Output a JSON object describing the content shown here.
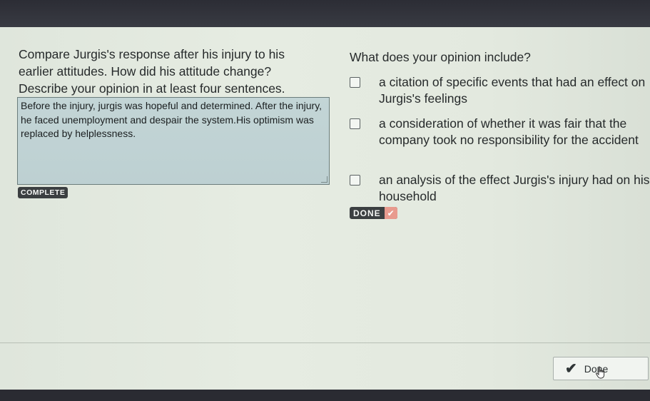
{
  "question": {
    "line1": "Compare Jurgis's response after his injury to his",
    "line2": "earlier attitudes. How did his attitude change?",
    "line3": "Describe your opinion in at least four sentences."
  },
  "answer": {
    "text": "Before the injury, jurgis was hopeful and determined. After the injury, he faced unemployment and despair the system.His optimism was replaced by helplessness."
  },
  "status": {
    "complete_label": "COMPLETE",
    "done_label": "DONE"
  },
  "checklist": {
    "heading": "What does your opinion include?",
    "items": [
      {
        "label": "a citation of specific events that had an effect on Jurgis's feelings",
        "checked": false
      },
      {
        "label": "a consideration of whether it was fair that the company took no responsibility for the accident",
        "checked": false
      },
      {
        "label": "an analysis of the effect Jurgis's injury had on his household",
        "checked": false
      }
    ]
  },
  "footer": {
    "done_button_label": "Done"
  },
  "colors": {
    "panel": "#e3e9df",
    "answer_box": "#c0d3d4",
    "badge": "#3b3f41",
    "done_check": "#e89a8e"
  },
  "icons": {
    "checkmark": "check-icon",
    "cursor": "hand-pointer-icon"
  }
}
